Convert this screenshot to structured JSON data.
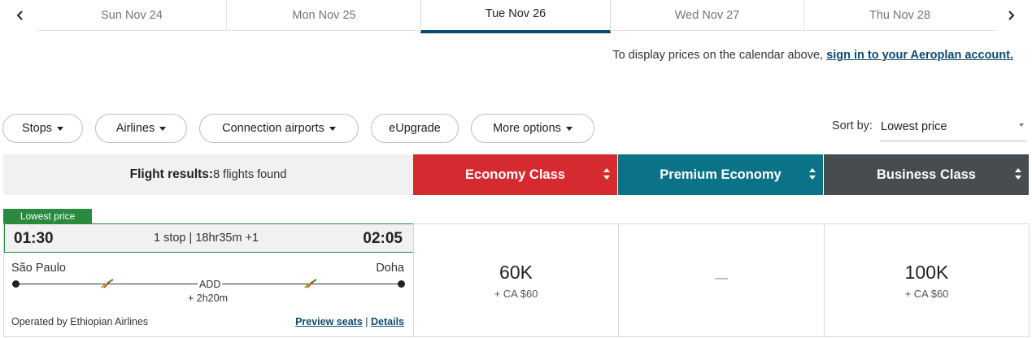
{
  "date_strip": {
    "prev_icon": "chevron-left-icon",
    "next_icon": "chevron-right-icon",
    "dates": [
      {
        "label": "Sun Nov 24",
        "active": false
      },
      {
        "label": "Mon Nov 25",
        "active": false
      },
      {
        "label": "Tue Nov 26",
        "active": true
      },
      {
        "label": "Wed Nov 27",
        "active": false
      },
      {
        "label": "Thu Nov 28",
        "active": false
      }
    ],
    "active_underline_color": "#0b4a70"
  },
  "signin_notice": {
    "text": "To display prices on the calendar above, ",
    "link": "sign in to your Aeroplan account."
  },
  "filters": {
    "stops": "Stops",
    "airlines": "Airlines",
    "connection_airports": "Connection airports",
    "eupgrade": "eUpgrade",
    "more_options": "More options"
  },
  "sort": {
    "label": "Sort by:",
    "value": "Lowest price"
  },
  "results_header": {
    "label": "Flight results:",
    "count": "8 flights found"
  },
  "cabins": [
    {
      "label": "Economy Class",
      "color": "#d52b30"
    },
    {
      "label": "Premium Economy",
      "color": "#0b7388"
    },
    {
      "label": "Business Class",
      "color": "#474c51"
    }
  ],
  "flight": {
    "badge": "Lowest price",
    "badge_color": "#2a8a3e",
    "departure_time": "01:30",
    "arrival_time": "02:05",
    "summary": "1 stop | 18hr35m +1",
    "origin": "São Paulo",
    "destination": "Doha",
    "connection": "ADD",
    "layover": "+ 2h20m",
    "operated_by": "Operated by Ethiopian Airlines",
    "preview_seats": "Preview seats",
    "separator": "|",
    "details": "Details",
    "airline_icon": "ethiopian-airlines-logo-icon",
    "prices": {
      "economy": {
        "points": "60K",
        "cash": "+ CA $60"
      },
      "premium": {
        "none": "—"
      },
      "business": {
        "points": "100K",
        "cash": "+ CA $60"
      }
    }
  }
}
